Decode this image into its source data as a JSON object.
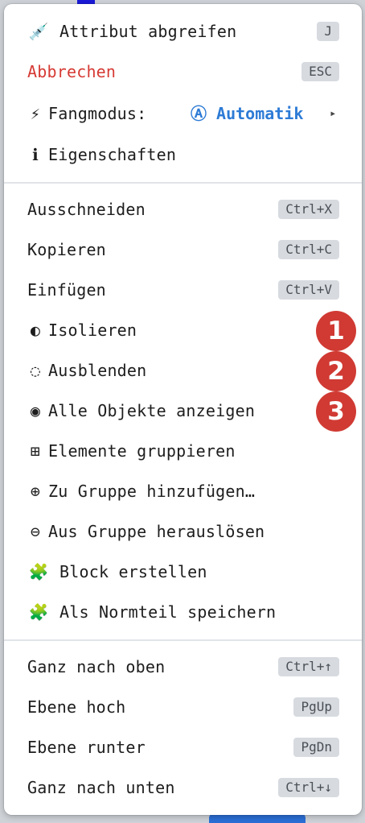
{
  "groups": {
    "top": [
      {
        "icon": "💉",
        "label": "Attribut abgreifen",
        "shortcut": "J"
      },
      {
        "label": "Abbrechen",
        "shortcut": "ESC"
      },
      {
        "icon": "⚡",
        "label": "Fangmodus:",
        "value_icon": "Ⓐ",
        "value": "Automatik",
        "arrow": "▸"
      },
      {
        "icon": "ℹ",
        "label": "Eigenschaften"
      }
    ],
    "edit": [
      {
        "label": "Ausschneiden",
        "shortcut": "Ctrl+X"
      },
      {
        "label": "Kopieren",
        "shortcut": "Ctrl+C"
      },
      {
        "label": "Einfügen",
        "shortcut": "Ctrl+V"
      },
      {
        "icon": "◐",
        "label": "Isolieren",
        "badge": "1"
      },
      {
        "icon": "◌",
        "label": "Ausblenden",
        "badge": "2"
      },
      {
        "icon": "◉",
        "label": "Alle Objekte anzeigen",
        "badge": "3"
      },
      {
        "icon": "⊞",
        "label": "Elemente gruppieren"
      },
      {
        "icon": "⊕",
        "label": "Zu Gruppe hinzufügen…"
      },
      {
        "icon": "⊖",
        "label": "Aus Gruppe herauslösen"
      },
      {
        "icon": "🧩",
        "label": "Block erstellen"
      },
      {
        "icon": "🧩",
        "label": "Als Normteil speichern"
      }
    ],
    "order": [
      {
        "label": "Ganz nach oben",
        "shortcut": "Ctrl+↑"
      },
      {
        "label": "Ebene hoch",
        "shortcut": "PgUp"
      },
      {
        "label": "Ebene runter",
        "shortcut": "PgDn"
      },
      {
        "label": "Ganz nach unten",
        "shortcut": "Ctrl+↓"
      }
    ]
  },
  "colors": {
    "danger": "#d63a34",
    "accent": "#2d7bd6",
    "badge": "#d03a33"
  }
}
